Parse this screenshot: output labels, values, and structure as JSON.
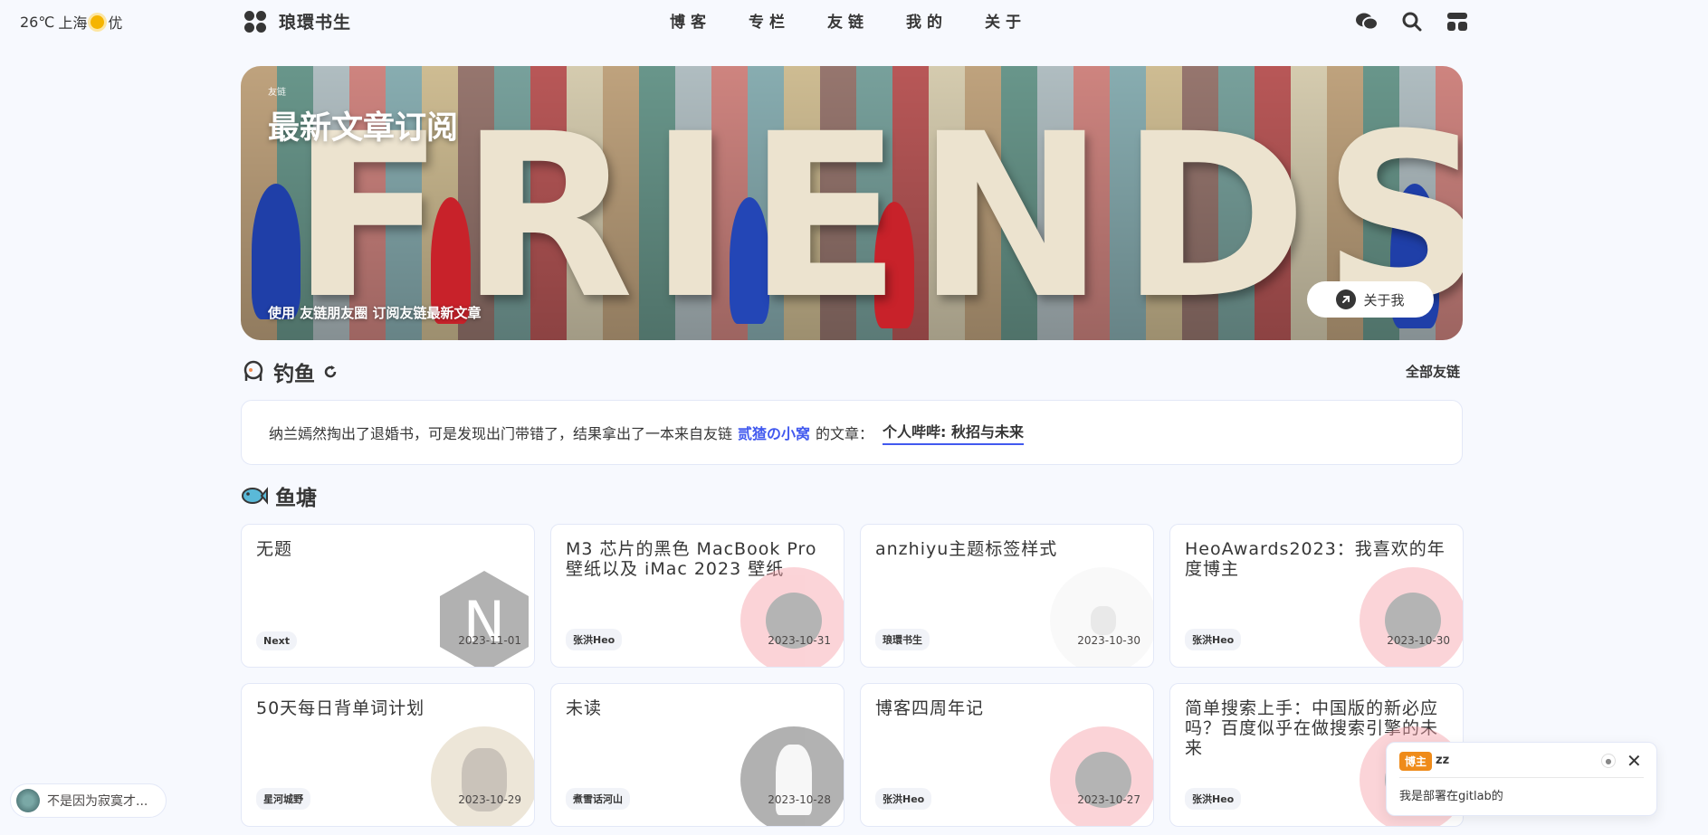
{
  "header": {
    "weather": {
      "temp": "26℃",
      "city": "上海",
      "quality": "优"
    },
    "brand_name": "琅環书生",
    "nav": [
      "博客",
      "专栏",
      "友链",
      "我的",
      "关于"
    ]
  },
  "banner": {
    "tag": "友链",
    "title": "最新文章订阅",
    "word": "FRIENDS",
    "desc": "使用 友链朋友圈 订阅友链最新文章",
    "about_label": "关于我"
  },
  "fishing": {
    "title": "钓鱼",
    "all_links": "全部友链",
    "text_before": "纳兰嫣然掏出了退婚书，可是发现出门带错了，结果拿出了一本来自友链",
    "friend": "贰猹の小窝",
    "text_mid": "的文章：",
    "article": "个人哔哔: 秋招与未来"
  },
  "pond": {
    "title": "鱼塘",
    "posts": [
      {
        "title": "无题",
        "author": "Next",
        "date": "2023-11-01"
      },
      {
        "title": "M3 芯片的黑色 MacBook Pro 壁纸以及 iMac 2023 壁纸",
        "author": "张洪Heo",
        "date": "2023-10-31"
      },
      {
        "title": "anzhiyu主题标签样式",
        "author": "琅環书生",
        "date": "2023-10-30"
      },
      {
        "title": "HeoAwards2023：我喜欢的年度博主",
        "author": "张洪Heo",
        "date": "2023-10-30"
      },
      {
        "title": "50天每日背单词计划",
        "author": "星河城野",
        "date": "2023-10-29"
      },
      {
        "title": "未读",
        "author": "煮雪话河山",
        "date": "2023-10-28"
      },
      {
        "title": "博客四周年记",
        "author": "张洪Heo",
        "date": "2023-10-27"
      },
      {
        "title": "简单搜索上手：中国版的新必应吗？百度似乎在做搜索引擎的未来",
        "author": "张洪Heo",
        "date": "2023-10-27"
      }
    ]
  },
  "music": {
    "text": "不是因为寂寞才..."
  },
  "popup": {
    "badge": "博主",
    "user": "zz",
    "message": "我是部署在gitlab的"
  }
}
